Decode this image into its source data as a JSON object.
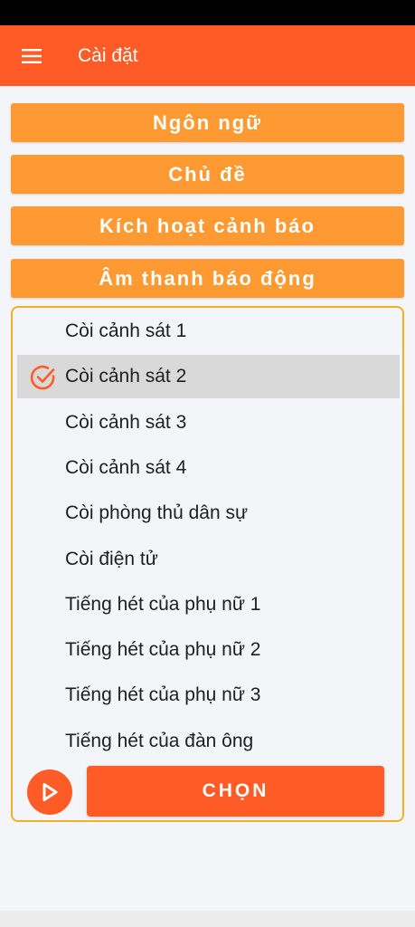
{
  "app_bar": {
    "title": "Cài đặt"
  },
  "sections": [
    {
      "label": "Ngôn ngữ"
    },
    {
      "label": "Chủ đề"
    },
    {
      "label": "Kích hoạt cảnh báo"
    },
    {
      "label": "Âm thanh báo động"
    }
  ],
  "sounds": {
    "selected_index": 1,
    "items": [
      {
        "label": "Còi cảnh sát 1"
      },
      {
        "label": "Còi cảnh sát 2"
      },
      {
        "label": "Còi cảnh sát 3"
      },
      {
        "label": "Còi cảnh sát 4"
      },
      {
        "label": "Còi phòng thủ dân sự"
      },
      {
        "label": "Còi điện tử"
      },
      {
        "label": "Tiếng hét của phụ nữ 1"
      },
      {
        "label": "Tiếng hét của phụ nữ 2"
      },
      {
        "label": "Tiếng hét của phụ nữ 3"
      },
      {
        "label": "Tiếng hét của đàn ông"
      }
    ]
  },
  "actions": {
    "choose_label": "CHỌN"
  },
  "icons": {
    "menu": "menu-icon",
    "check": "check-circle-icon",
    "play": "play-icon"
  },
  "colors": {
    "primary": "#ff5b27",
    "section_button": "#ff9a33",
    "panel_border": "#f3b026",
    "selected_row": "#d9d9d9"
  }
}
